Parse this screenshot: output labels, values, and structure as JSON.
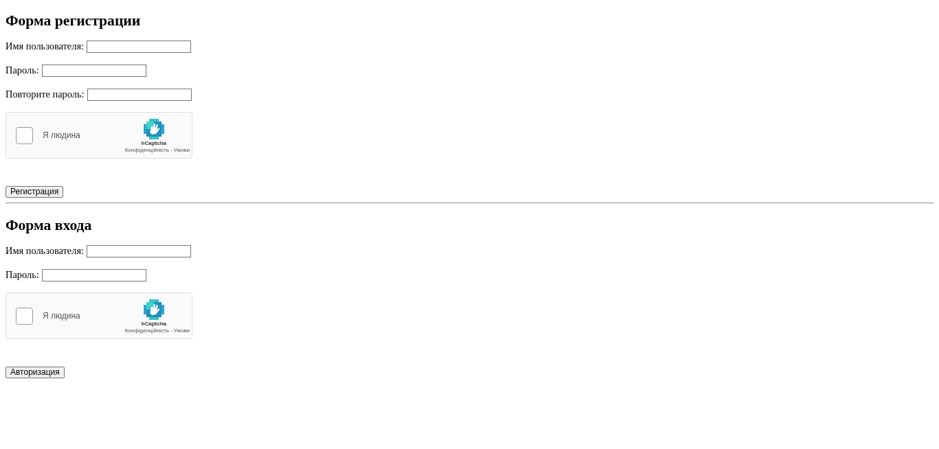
{
  "forms": [
    {
      "title": "Форма регистрации",
      "fields": [
        {
          "label": "Имя пользователя:"
        },
        {
          "label": "Пароль:"
        },
        {
          "label": "Повторите пароль:"
        }
      ],
      "captcha": {
        "label": "Я людина",
        "checked": false,
        "brand": "hCaptcha",
        "links": [
          "Конфіденційність",
          "Умови"
        ],
        "separator": "-"
      },
      "button": "Регистрация"
    },
    {
      "title": "Форма входа",
      "fields": [
        {
          "label": "Имя пользователя:"
        },
        {
          "label": "Пароль:"
        }
      ],
      "captcha": {
        "label": "Я людина",
        "checked": false,
        "brand": "hCaptcha",
        "links": [
          "Конфіденційність",
          "Умови"
        ],
        "separator": "-"
      },
      "button": "Авторизация"
    }
  ]
}
